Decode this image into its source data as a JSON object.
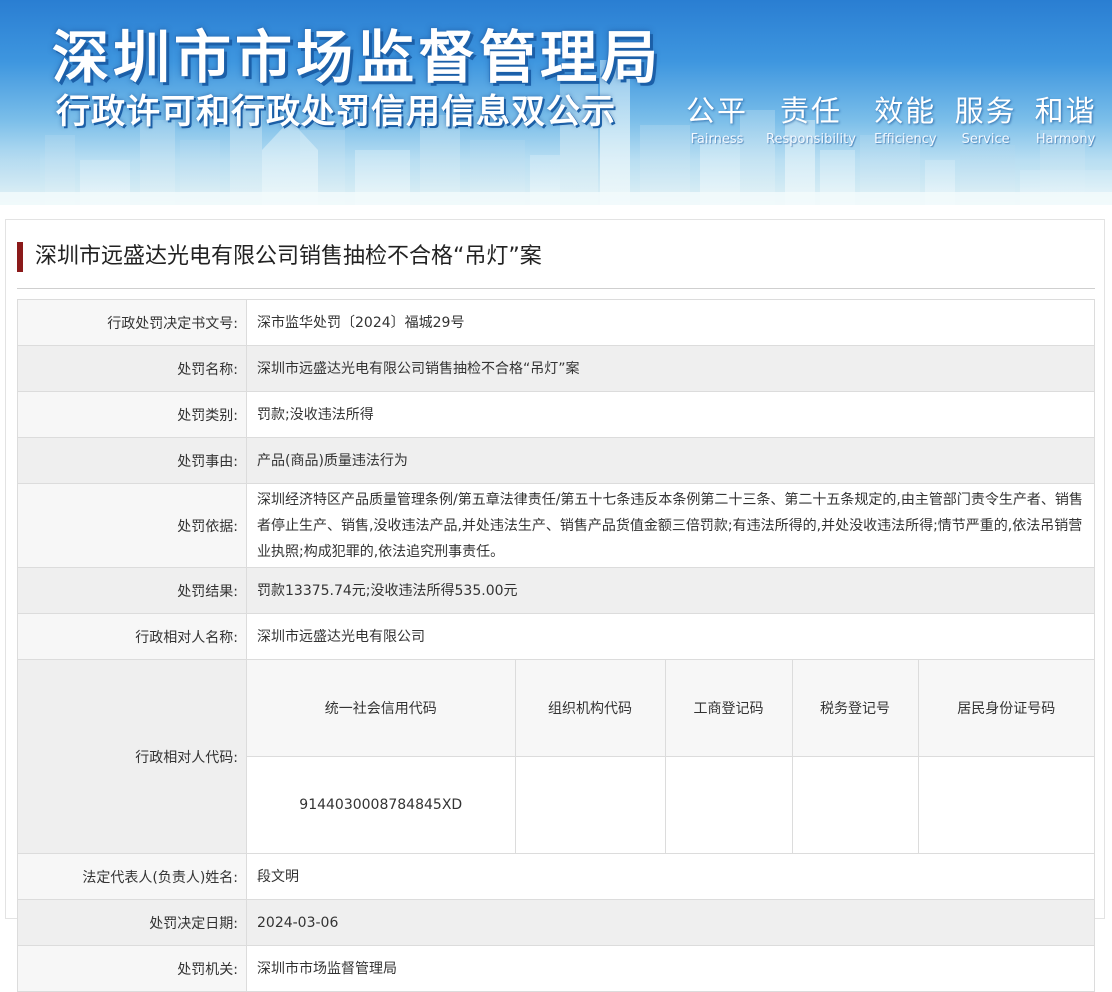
{
  "banner": {
    "title": "深圳市市场监督管理局",
    "subtitle": "行政许可和行政处罚信用信息双公示",
    "slogans": [
      {
        "cn": "公平",
        "en": "Fairness"
      },
      {
        "cn": "责任",
        "en": "Responsibility"
      },
      {
        "cn": "效能",
        "en": "Efficiency"
      },
      {
        "cn": "服务",
        "en": "Service"
      },
      {
        "cn": "和谐",
        "en": "Harmony"
      }
    ]
  },
  "case": {
    "title": "深圳市远盛达光电有限公司销售抽检不合格“吊灯”案"
  },
  "fields": {
    "decision_no": {
      "label": "行政处罚决定书文号:",
      "value": "深市监华处罚〔2024〕福城29号"
    },
    "penalty_name": {
      "label": "处罚名称:",
      "value": "深圳市远盛达光电有限公司销售抽检不合格“吊灯”案"
    },
    "penalty_type": {
      "label": "处罚类别:",
      "value": "罚款;没收违法所得"
    },
    "penalty_reason": {
      "label": "处罚事由:",
      "value": "产品(商品)质量违法行为"
    },
    "penalty_basis": {
      "label": "处罚依据:",
      "value": "深圳经济特区产品质量管理条例/第五章法律责任/第五十七条违反本条例第二十三条、第二十五条规定的,由主管部门责令生产者、销售者停止生产、销售,没收违法产品,并处违法生产、销售产品货值金额三倍罚款;有违法所得的,并处没收违法所得;情节严重的,依法吊销营业执照;构成犯罪的,依法追究刑事责任。"
    },
    "penalty_result": {
      "label": "处罚结果:",
      "value": "罚款13375.74元;没收违法所得535.00元"
    },
    "party_name": {
      "label": "行政相对人名称:",
      "value": "深圳市远盛达光电有限公司"
    },
    "party_code": {
      "label": "行政相对人代码:",
      "headers": [
        "统一社会信用代码",
        "组织机构代码",
        "工商登记码",
        "税务登记号",
        "居民身份证号码"
      ],
      "values": [
        "9144030008784845XD",
        "",
        "",
        "",
        ""
      ]
    },
    "legal_rep": {
      "label": "法定代表人(负责人)姓名:",
      "value": "段文明"
    },
    "decision_date": {
      "label": "处罚决定日期:",
      "value": "2024-03-06"
    },
    "authority": {
      "label": "处罚机关:",
      "value": "深圳市市场监督管理局"
    }
  },
  "colors": {
    "title_accent": "#8b1a1a",
    "label_bg": "#f7f7f7",
    "alt_row_bg": "#efefef",
    "banner_top": "#2a7ed2"
  }
}
